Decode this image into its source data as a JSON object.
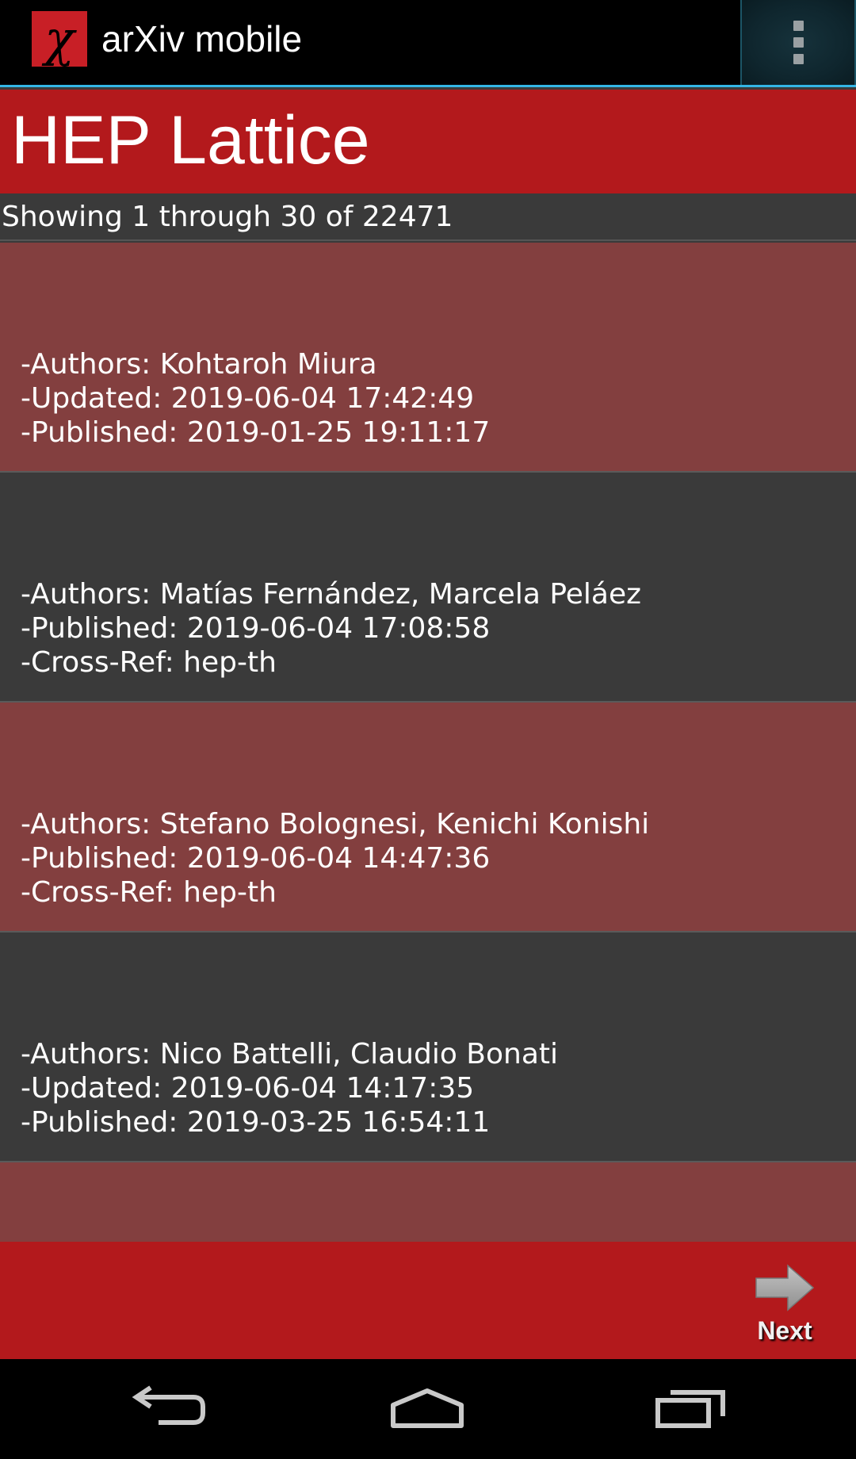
{
  "action_bar": {
    "logo_glyph": "χ",
    "title": "arXiv mobile",
    "overflow_icon": "overflow-menu-icon"
  },
  "category": {
    "title": "HEP Lattice"
  },
  "results": {
    "summary": "Showing 1 through 30 of 22471"
  },
  "papers": [
    {
      "lines": [
        "-Authors: Kohtaroh Miura",
        "-Updated: 2019-06-04 17:42:49",
        "-Published: 2019-01-25 19:11:17"
      ]
    },
    {
      "lines": [
        "-Authors: Matías Fernández, Marcela Peláez",
        "-Published: 2019-06-04 17:08:58",
        "-Cross-Ref: hep-th"
      ]
    },
    {
      "lines": [
        "-Authors: Stefano Bolognesi, Kenichi Konishi",
        "-Published: 2019-06-04 14:47:36",
        "-Cross-Ref: hep-th"
      ]
    },
    {
      "lines": [
        "-Authors: Nico Battelli, Claudio Bonati",
        "-Updated: 2019-06-04 14:17:35",
        "-Published: 2019-03-25 16:54:11"
      ]
    }
  ],
  "bottom_bar": {
    "next_label": "Next",
    "next_icon": "arrow-right-icon"
  },
  "nav_bar": {
    "back_icon": "back-icon",
    "home_icon": "home-icon",
    "recents_icon": "recents-icon"
  },
  "colors": {
    "accent_red": "#b3191c",
    "item_red": "#833f3f",
    "item_gray": "#3a3a3a",
    "holo_blue": "#33b5e5"
  }
}
